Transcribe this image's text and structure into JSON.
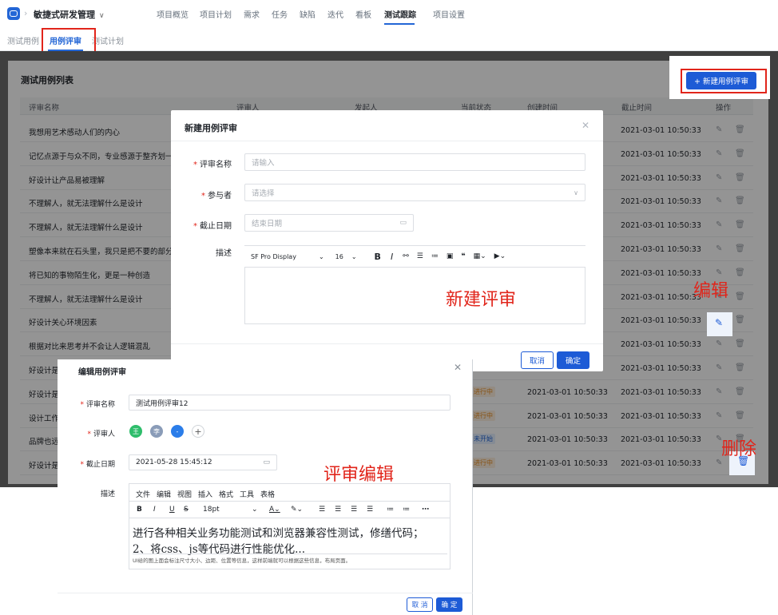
{
  "topbar": {
    "project_name": "敏捷式研发管理",
    "nav_tabs": [
      "项目概览",
      "项目计划",
      "需求",
      "任务",
      "缺陷",
      "迭代",
      "看板",
      "测试跟踪",
      "项目设置"
    ],
    "active_tab": "测试跟踪"
  },
  "subtabs": [
    "测试用例",
    "用例评审",
    "测试计划"
  ],
  "active_subtab": "用例评审",
  "list": {
    "title": "测试用例列表",
    "new_button": "+ 新建用例评审",
    "columns": [
      "评审名称",
      "评审人",
      "发起人",
      "当前状态",
      "创建时间",
      "截止时间",
      "操作"
    ],
    "rows": [
      {
        "name": "我想用艺术感动人们的内心",
        "status": "",
        "created": "",
        "deadline": "2021-03-01 10:50:33"
      },
      {
        "name": "记忆点源于与众不同，专业感源于整齐划一",
        "status": "",
        "created": "",
        "deadline": "2021-03-01 10:50:33"
      },
      {
        "name": "好设计让产品易被理解",
        "status": "",
        "created": "",
        "deadline": "2021-03-01 10:50:33"
      },
      {
        "name": "不理解人，就无法理解什么是设计",
        "status": "",
        "created": "",
        "deadline": "2021-03-01 10:50:33"
      },
      {
        "name": "不理解人，就无法理解什么是设计",
        "status": "",
        "created": "",
        "deadline": "2021-03-01 10:50:33"
      },
      {
        "name": "塑像本来就在石头里，我只是把不要的部分去掉",
        "status": "",
        "created": "",
        "deadline": "2021-03-01 10:50:33"
      },
      {
        "name": "将已知的事物陌生化，更是一种创造",
        "status": "",
        "created": "",
        "deadline": "2021-03-01 10:50:33"
      },
      {
        "name": "不理解人，就无法理解什么是设计",
        "status": "",
        "created": "",
        "deadline": "2021-03-01 10:50:33"
      },
      {
        "name": "好设计关心环境因素",
        "status": "",
        "created": "",
        "deadline": "2021-03-01 10:50:33"
      },
      {
        "name": "根据对比来思考并不会让人逻辑混乱",
        "status": "",
        "created": "",
        "deadline": "2021-03-01 10:50:33"
      },
      {
        "name": "好设计是",
        "status": "",
        "created": "",
        "deadline": "2021-03-01 10:50:33"
      },
      {
        "name": "好设计是",
        "status": "进行中",
        "created": "2021-03-01 10:50:33",
        "deadline": "2021-03-01 10:50:33"
      },
      {
        "name": "设计工作",
        "status": "进行中",
        "created": "2021-03-01 10:50:33",
        "deadline": "2021-03-01 10:50:33"
      },
      {
        "name": "品牌也远",
        "status": "未开始",
        "created": "2021-03-01 10:50:33",
        "deadline": "2021-03-01 10:50:33"
      },
      {
        "name": "好设计是",
        "status": "进行中",
        "created": "2021-03-01 10:50:33",
        "deadline": "2021-03-01 10:50:33"
      }
    ]
  },
  "new_modal": {
    "title": "新建用例评审",
    "name_label": "评审名称",
    "name_placeholder": "请输入",
    "participants_label": "参与者",
    "participants_placeholder": "请选择",
    "deadline_label": "截止日期",
    "deadline_placeholder": "结束日期",
    "desc_label": "描述",
    "font_family": "SF Pro Display",
    "font_size": "16",
    "cancel": "取消",
    "confirm": "确定"
  },
  "annotations": {
    "new_review": "新建评审",
    "edit": "编辑",
    "delete": "删除",
    "review_edit": "评审编辑"
  },
  "edit_modal": {
    "title": "编辑用例评审",
    "name_label": "评审名称",
    "name_value": "测试用例评审12",
    "reviewers_label": "评审人",
    "reviewers": [
      {
        "initial": "王",
        "color": "#2ebd6b"
      },
      {
        "initial": "李",
        "color": "#8a9cb8"
      },
      {
        "initial": "-",
        "color": "#2b7de9"
      }
    ],
    "deadline_label": "截止日期",
    "deadline_value": "2021-05-28 15:45:12",
    "desc_label": "描述",
    "menu": [
      "文件",
      "编辑",
      "视图",
      "插入",
      "格式",
      "工具",
      "表格"
    ],
    "font_size": "18pt",
    "content_line1": "进行各种相关业务功能测试和浏览器兼容性测试，修缮代码；",
    "content_line2": "2、将css、js等代码进行性能优化...",
    "content_note": "UI给的图上面会标注尺寸大小、边距、位置等信息，这样前端就可以根据这些信息，布局页面。",
    "cancel": "取 消",
    "confirm": "确 定"
  },
  "colors": {
    "primary": "#1d5bd6",
    "annotation_red": "#e1251b"
  }
}
